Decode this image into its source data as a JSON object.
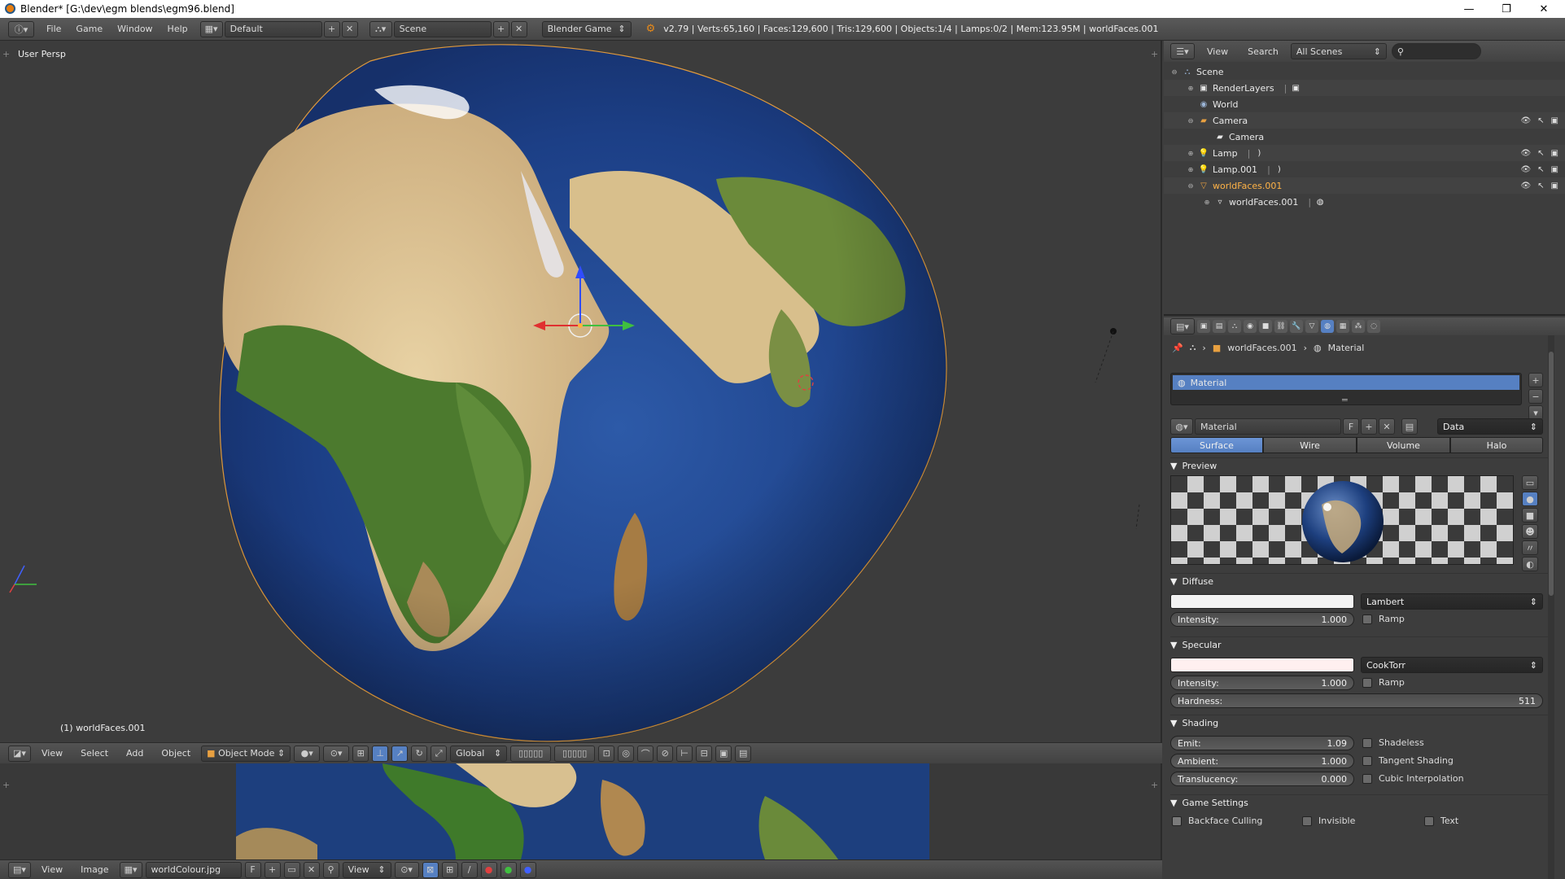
{
  "window": {
    "title": "Blender* [G:\\dev\\egm blends\\egm96.blend]",
    "minimize": "—",
    "maximize": "❐",
    "close": "✕"
  },
  "infobar": {
    "menus": [
      "File",
      "Game",
      "Window",
      "Help"
    ],
    "screen_layout": "Default",
    "scene": "Scene",
    "engine": "Blender Game",
    "stats": "v2.79 | Verts:65,160 | Faces:129,600 | Tris:129,600 | Objects:1/4 | Lamps:0/2 | Mem:123.95M | worldFaces.001"
  },
  "viewport": {
    "label": "User Persp",
    "active_object": "(1) worldFaces.001",
    "menus": [
      "View",
      "Select",
      "Add",
      "Object"
    ],
    "mode": "Object Mode",
    "orientation": "Global"
  },
  "image_editor": {
    "menus": [
      "View",
      "Image"
    ],
    "image_name": "worldColour.jpg",
    "fake_user": "F",
    "view_menu": "View"
  },
  "outliner": {
    "menus": [
      "View",
      "Search"
    ],
    "display_mode": "All Scenes",
    "items": [
      {
        "label": "Scene",
        "icon": "scene-icon",
        "indent": 0,
        "expand": "⊖"
      },
      {
        "label": "RenderLayers",
        "icon": "renderlayers-icon",
        "indent": 1,
        "expand": "⊕"
      },
      {
        "label": "World",
        "icon": "world-icon",
        "indent": 1,
        "expand": ""
      },
      {
        "label": "Camera",
        "icon": "camera-icon",
        "indent": 1,
        "expand": "⊖",
        "vis": true
      },
      {
        "label": "Camera",
        "icon": "camera-data-icon",
        "indent": 2,
        "expand": ""
      },
      {
        "label": "Lamp",
        "icon": "lamp-icon",
        "indent": 1,
        "expand": "⊕",
        "vis": true
      },
      {
        "label": "Lamp.001",
        "icon": "lamp-icon",
        "indent": 1,
        "expand": "⊕",
        "vis": true
      },
      {
        "label": "worldFaces.001",
        "icon": "mesh-object-icon",
        "indent": 1,
        "expand": "⊖",
        "vis": true
      },
      {
        "label": "worldFaces.001",
        "icon": "mesh-data-icon",
        "indent": 2,
        "expand": "⊕"
      }
    ]
  },
  "properties": {
    "breadcrumb_object": "worldFaces.001",
    "breadcrumb_material": "Material",
    "material_slot": "Material",
    "material_name": "Material",
    "fake_user": "F",
    "link": "Data",
    "tabs": [
      "Surface",
      "Wire",
      "Volume",
      "Halo"
    ],
    "active_tab": "Surface",
    "preview_label": "Preview",
    "diffuse": {
      "label": "Diffuse",
      "color": "#f2f2f2",
      "shader": "Lambert",
      "intensity_label": "Intensity:",
      "intensity": "1.000",
      "ramp": "Ramp"
    },
    "specular": {
      "label": "Specular",
      "color": "#fff0f0",
      "shader": "CookTorr",
      "intensity_label": "Intensity:",
      "intensity": "1.000",
      "ramp": "Ramp",
      "hardness_label": "Hardness:",
      "hardness": "511"
    },
    "shading": {
      "label": "Shading",
      "emit_label": "Emit:",
      "emit": "1.09",
      "ambient_label": "Ambient:",
      "ambient": "1.000",
      "translucency_label": "Translucency:",
      "translucency": "0.000",
      "shadeless": "Shadeless",
      "tangent_shading": "Tangent Shading",
      "cubic_interpolation": "Cubic Interpolation"
    },
    "game_settings": {
      "label": "Game Settings",
      "backface_culling": "Backface Culling",
      "invisible": "Invisible",
      "text": "Text"
    }
  }
}
